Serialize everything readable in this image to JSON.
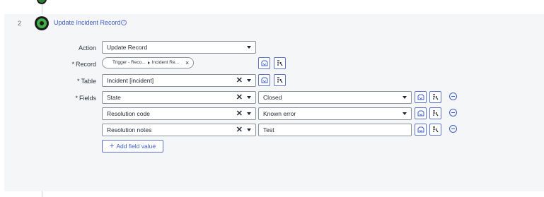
{
  "step": {
    "number": "2",
    "title": "Update Incident Record",
    "help_glyph": "?"
  },
  "form": {
    "action": {
      "label": "Action",
      "value": "Update Record"
    },
    "record": {
      "label": "Record",
      "required": "*",
      "pill": {
        "first": "Trigger - Reco...",
        "second": "Incident Re...",
        "remove": "×"
      }
    },
    "table": {
      "label": "Table",
      "required": "*",
      "value": "Incident [incident]",
      "clear": "✕"
    },
    "fields": {
      "label": "Fields",
      "required": "*",
      "rows": [
        {
          "field": "State",
          "value": "Closed",
          "value_type": "select"
        },
        {
          "field": "Resolution code",
          "value": "Known error",
          "value_type": "select"
        },
        {
          "field": "Resolution notes",
          "value": "Test",
          "value_type": "text"
        }
      ],
      "clear": "✕"
    },
    "add_field_value_label": "Add field value",
    "add_plus": "+"
  },
  "icons": {
    "data_pill_picker": "data-pill-picker-icon",
    "dot_walk": "dot-walk-tree-icon",
    "remove_row": "remove-circle-icon",
    "help": "help-circle-icon"
  },
  "colors": {
    "accent": "#3b5cc9",
    "step_green": "#3fae49",
    "panel_bg": "#f5f6f7"
  }
}
